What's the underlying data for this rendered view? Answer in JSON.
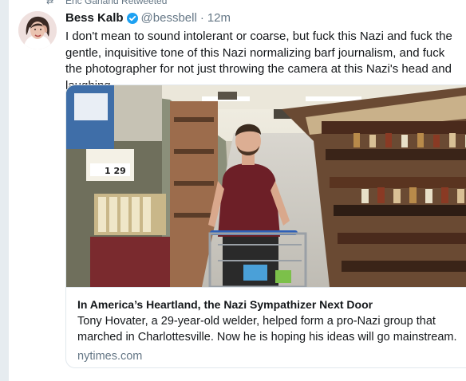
{
  "retweet": {
    "text": "Eric Garland Retweeted"
  },
  "tweet": {
    "display_name": "Bess Kalb",
    "handle": "@bessbell",
    "separator": "·",
    "time": "12m",
    "text": "I don't mean to sound intolerant or coarse, but fuck this Nazi and fuck the gentle, inquisitive tone of this Nazi normalizing barf journalism, and fuck the photographer for not just throwing the camera at this Nazi's head and laughing."
  },
  "card": {
    "image_price": "1 29",
    "title": "In America’s Heartland, the Nazi Sympathizer Next Door",
    "description": "Tony Hovater, a 29-year-old welder, helped form a pro-Nazi group that marched in Charlottesville. Now he is hoping his ideas will go mainstream.",
    "domain": "nytimes.com"
  },
  "colors": {
    "text": "#14171a",
    "muted": "#657786",
    "verified": "#1da1f2",
    "border": "#e1e8ed"
  }
}
